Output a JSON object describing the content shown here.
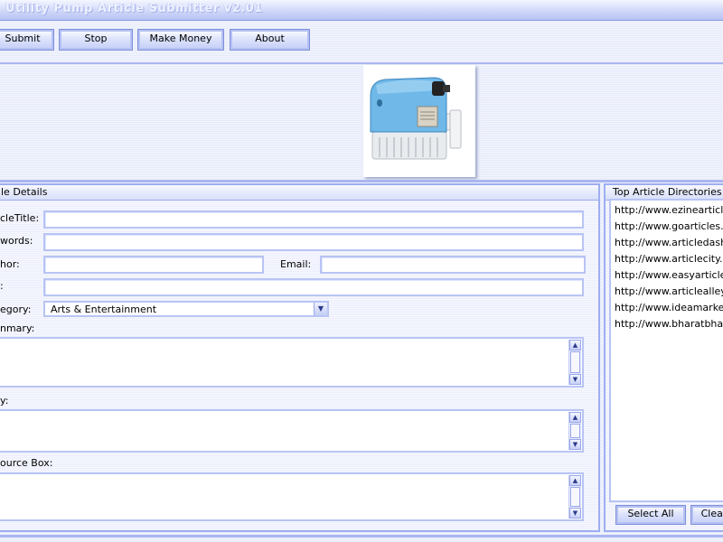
{
  "window": {
    "title": "Utility Pump Article Submitter  v2.01"
  },
  "toolbar": {
    "submit_label": "Submit",
    "stop_label": "Stop",
    "make_money_label": "Make Money",
    "about_label": "About"
  },
  "article_panel": {
    "title": "le Details",
    "article_title_label": "cleTitle:",
    "keywords_label": "words:",
    "author_label": "hor:",
    "email_label": "Email:",
    "url_label": ":",
    "category_label": "egory:",
    "category_selected": "Arts & Entertainment",
    "summary_label": "nmary:",
    "body_label": "y:",
    "resource_box_label": "ource Box:"
  },
  "directories_panel": {
    "title": "Top Article Directories",
    "items": [
      "http://www.ezinearticles",
      "http://www.goarticles.co",
      "http://www.articledashbo",
      "http://www.articlecity.co",
      "http://www.easyarticles",
      "http://www.articlealley.c",
      "http://www.ideamarketer",
      "http://www.bharatbhash"
    ],
    "select_all_label": "Select All",
    "clear_label": "Clear"
  }
}
